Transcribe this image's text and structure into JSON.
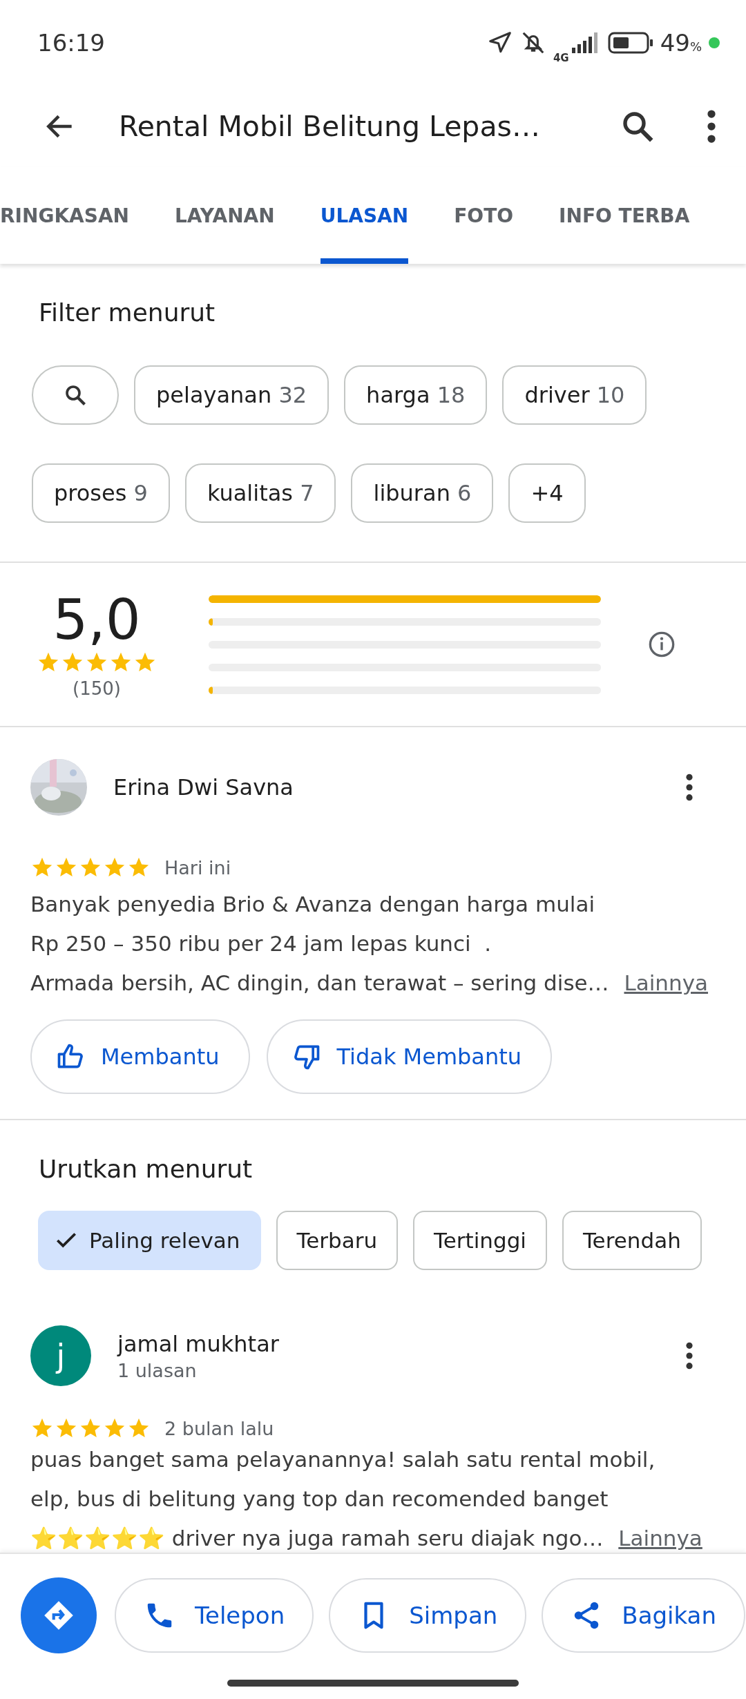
{
  "status_bar": {
    "time": "16:19",
    "network": "4G",
    "battery": "49",
    "battery_unit": "%"
  },
  "toolbar": {
    "title": "Rental Mobil Belitung Lepas…"
  },
  "tabs": [
    {
      "label": "RINGKASAN",
      "selected": false
    },
    {
      "label": "LAYANAN",
      "selected": false
    },
    {
      "label": "ULASAN",
      "selected": true
    },
    {
      "label": "FOTO",
      "selected": false
    },
    {
      "label": "INFO TERBA",
      "selected": false
    }
  ],
  "filter": {
    "heading": "Filter menurut",
    "chips": [
      {
        "kind": "search"
      },
      {
        "kind": "topic",
        "label": "pelayanan",
        "count": "32"
      },
      {
        "kind": "topic",
        "label": "harga",
        "count": "18"
      },
      {
        "kind": "topic",
        "label": "driver",
        "count": "10"
      },
      {
        "kind": "topic",
        "label": "proses",
        "count": "9"
      },
      {
        "kind": "topic",
        "label": "kualitas",
        "count": "7"
      },
      {
        "kind": "topic",
        "label": "liburan",
        "count": "6"
      },
      {
        "kind": "more",
        "label": "+4"
      }
    ]
  },
  "rating": {
    "score": "5,0",
    "stars": 5,
    "count": "(150)",
    "bars": [
      {
        "level": 1
      },
      {
        "level": 0.01
      },
      {
        "level": 0
      },
      {
        "level": 0
      },
      {
        "level": 0.01
      }
    ]
  },
  "review": {
    "author": "Erina Dwi Savna",
    "stars": 5,
    "date": "Hari ini",
    "text": "Banyak penyedia Brio & Avanza dengan harga mulai\nRp 250 – 350 ribu per 24 jam lepas kunci  .\nArmada bersih, AC dingin, dan terawat – sering dise…",
    "more": "Lainnya",
    "buttons": [
      "Membantu",
      "Tidak Membantu"
    ]
  },
  "sort": {
    "heading": "Urutkan menurut",
    "options": [
      {
        "label": "Paling relevan",
        "selected": true
      },
      {
        "label": "Terbaru",
        "selected": false
      },
      {
        "label": "Tertinggi",
        "selected": false
      },
      {
        "label": "Terendah",
        "selected": false
      }
    ]
  },
  "review_2": {
    "initial": "j",
    "author": "jamal mukhtar",
    "meta": "1 ulasan",
    "stars": 5,
    "date": "2 bulan lalu",
    "text": "puas banget sama pelayanannya! salah satu rental mobil,\nelp, bus di belitung yang top dan recomended banget\n⭐⭐⭐⭐⭐ driver nya juga ramah seru diajak ngo…",
    "more": "Lainnya"
  },
  "actions": [
    {
      "kind": "primary"
    },
    {
      "kind": "outlined",
      "label": "Telepon"
    },
    {
      "kind": "outlined",
      "label": "Simpan"
    },
    {
      "kind": "outlined",
      "label": "Bagikan"
    }
  ]
}
